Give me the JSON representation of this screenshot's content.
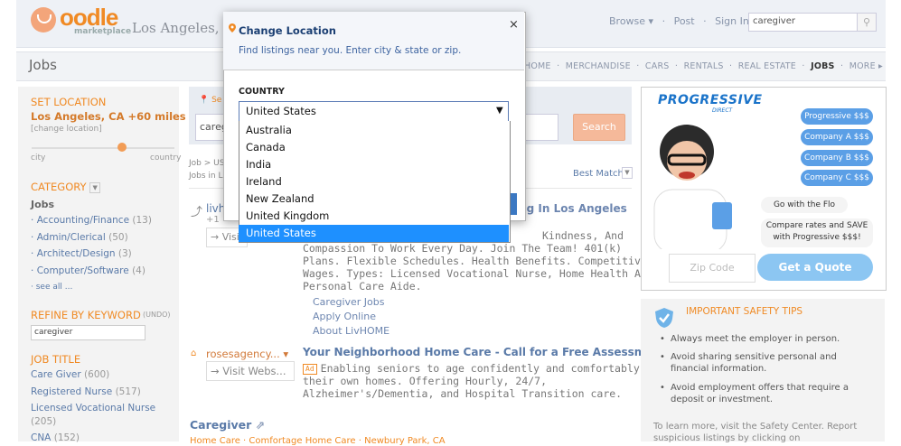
{
  "header": {
    "logo_word": "oodle",
    "logo_sub": "marketplace",
    "city": "Los Angeles, CA",
    "nav": [
      "Browse ▾",
      "·",
      "Post",
      "·",
      "Sign In"
    ],
    "search_value": "caregiver"
  },
  "subheader": {
    "title": "Jobs",
    "categories": [
      "HOME",
      "MERCHANDISE",
      "CARS",
      "RENTALS",
      "REAL ESTATE",
      "JOBS",
      "MORE ▸"
    ]
  },
  "sidebar": {
    "set_location_title": "SET LOCATION",
    "location_value": "Los Angeles, CA +60 miles",
    "change_location": "[change location]",
    "slider_min_label": "city",
    "slider_max_label": "country",
    "slider_value": 0.6,
    "category_title": "CATEGORY",
    "category_current": "Jobs",
    "categories": [
      {
        "label": "Accounting/Finance",
        "count": "(13)"
      },
      {
        "label": "Admin/Clerical",
        "count": "(50)"
      },
      {
        "label": "Architect/Design",
        "count": "(3)"
      },
      {
        "label": "Computer/Software",
        "count": "(4)"
      },
      {
        "label": "see all ...",
        "count": ""
      }
    ],
    "keyword_title": "REFINE BY KEYWORD",
    "keyword_undo": "(UNDO)",
    "keyword_value": "caregiver",
    "job_title_title": "JOB TITLE",
    "job_titles": [
      {
        "label": "Care Giver",
        "count": "(600)"
      },
      {
        "label": "Registered Nurse",
        "count": "(517)"
      },
      {
        "label": "Licensed Vocational Nurse",
        "count": ""
      },
      {
        "label": "(205)",
        "count": ""
      },
      {
        "label": "CNA",
        "count": "(152)"
      }
    ]
  },
  "main": {
    "search_label": "Se",
    "search_value": "careg",
    "search_button": "Search",
    "crumb": "Job > US",
    "crumb2": "Jobs in L",
    "sort_label": "Best Match",
    "listing1": {
      "source": "livh",
      "plus": "+1",
      "visit": "Visi",
      "title": "ing In Los Angeles",
      "desc": [
        "Kindness, And",
        "Compassion To Work Every Day. Join The Team! 401(k)",
        "Plans. Flexible Schedules. Health Benefits. Competitive",
        "Wages. Types: Licensed Vocational Nurse, Home Health Aide,",
        "Personal Care Aide."
      ],
      "links": [
        "Caregiver Jobs",
        "Apply Online",
        "About LivHOME"
      ]
    },
    "listing2": {
      "source": "rosesagency... ▾",
      "visit": "Visit Webs...",
      "title": "Your Neighborhood Home Care - Call for a Free Assessment",
      "ad_badge": "Ad",
      "desc": [
        "Enabling seniors to age confidently and comfortably in",
        "their own homes. Offering Hourly, 24/7,",
        "Alzheimer's/Dementia, and Hospital Transition care."
      ]
    },
    "section_title": "Caregiver",
    "section_sub": "Home Care · Comfortage Home Care · Newbury Park, CA"
  },
  "ad": {
    "brand": "PROGRESSIVE",
    "brand_sub": "DIRECT",
    "pills": [
      "Progressive $$$",
      "Company A $$$",
      "Company B $$$",
      "Company C $$$"
    ],
    "bubble1": "Go with the Flo",
    "bubble2_line1": "Compare rates and SAVE",
    "bubble2_line2": "with Progressive $$$!",
    "zip_placeholder": "Zip Code",
    "quote_button": "Get a Quote",
    "accent": "#1a73c9"
  },
  "safety": {
    "title": "IMPORTANT SAFETY TIPS",
    "tips": [
      "Always meet the employer in person.",
      "Avoid sharing sensitive personal and financial information.",
      "Avoid employment offers that require a deposit or investment."
    ],
    "more": "To learn more, visit the Safety Center. Report suspicious listings by clicking on"
  },
  "modal": {
    "title": "Change Location",
    "close": "×",
    "desc": "Find listings near you. Enter city & state or zip.",
    "country_label": "COUNTRY",
    "selected": "United States",
    "options": [
      "Australia",
      "Canada",
      "India",
      "Ireland",
      "New Zealand",
      "United Kingdom",
      "United States"
    ],
    "highlight_color": "#1e90ff"
  }
}
